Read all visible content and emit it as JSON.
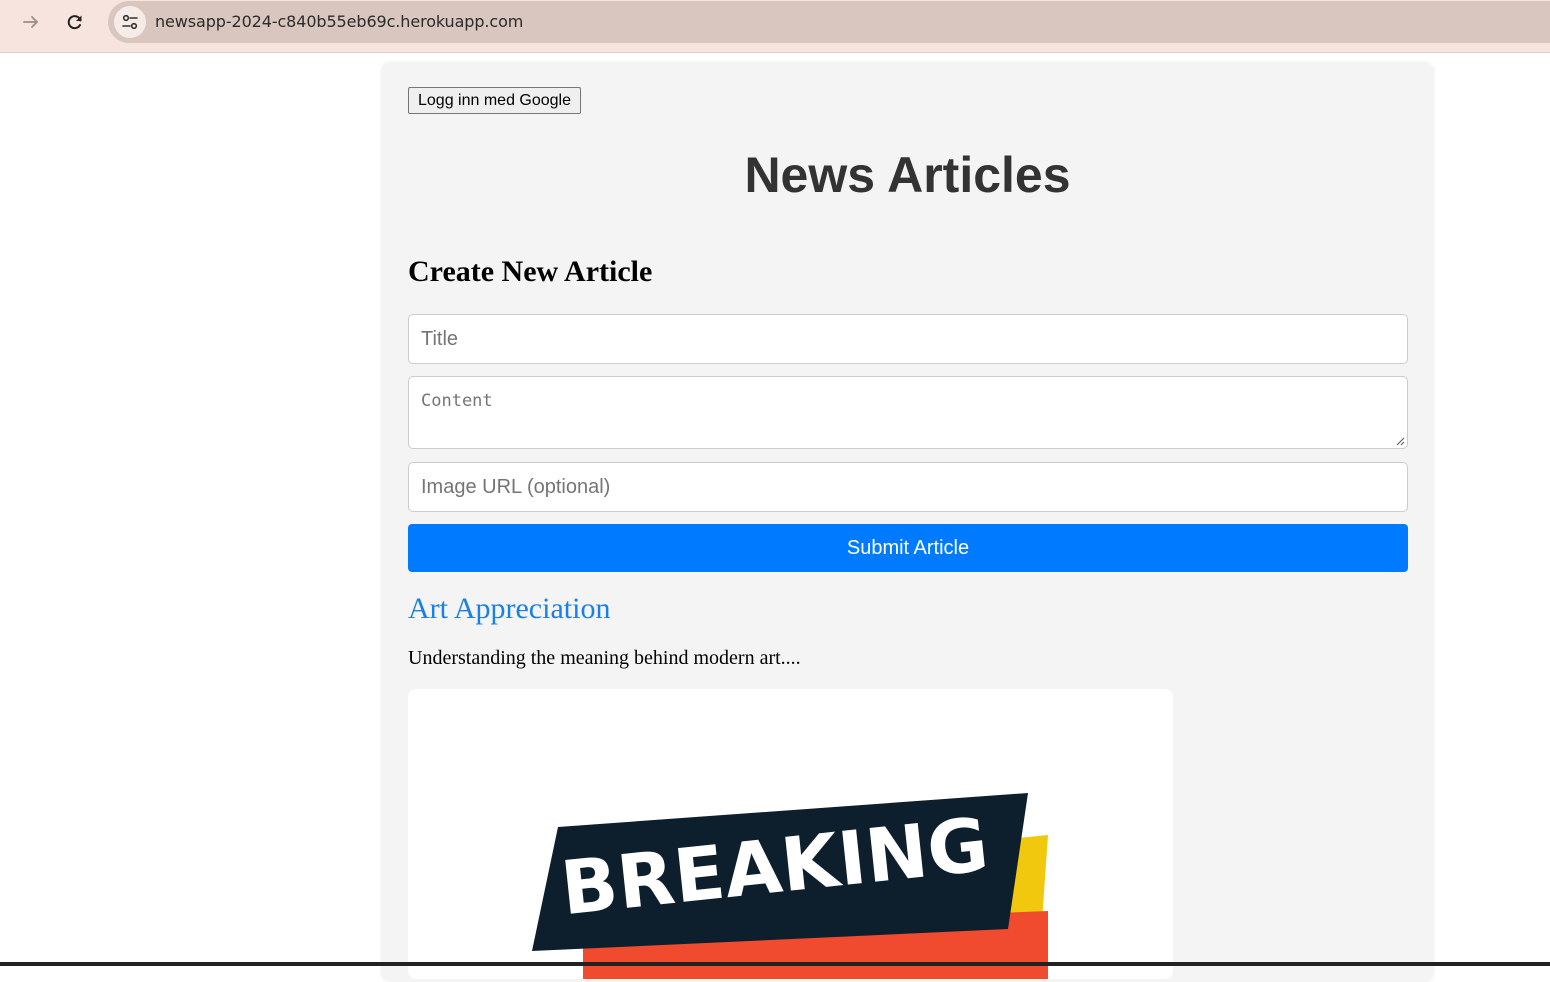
{
  "browser": {
    "url": "newsapp-2024-c840b55eb69c.herokuapp.com"
  },
  "auth": {
    "login_label": "Logg inn med Google"
  },
  "page": {
    "title": "News Articles"
  },
  "form": {
    "heading": "Create New Article",
    "title_placeholder": "Title",
    "content_placeholder": "Content",
    "image_placeholder": "Image URL (optional)",
    "submit_label": "Submit Article"
  },
  "articles": [
    {
      "title": "Art Appreciation",
      "excerpt": "Understanding the meaning behind modern art....",
      "image_text": "BREAKING"
    }
  ],
  "colors": {
    "accent": "#007bff",
    "link": "#1a7fe6",
    "chrome": "#f7e4de",
    "urlbar": "#d9c6bf",
    "banner_dark": "#0d1f2d",
    "banner_red": "#f04a2f",
    "banner_yellow": "#f2c80f"
  }
}
